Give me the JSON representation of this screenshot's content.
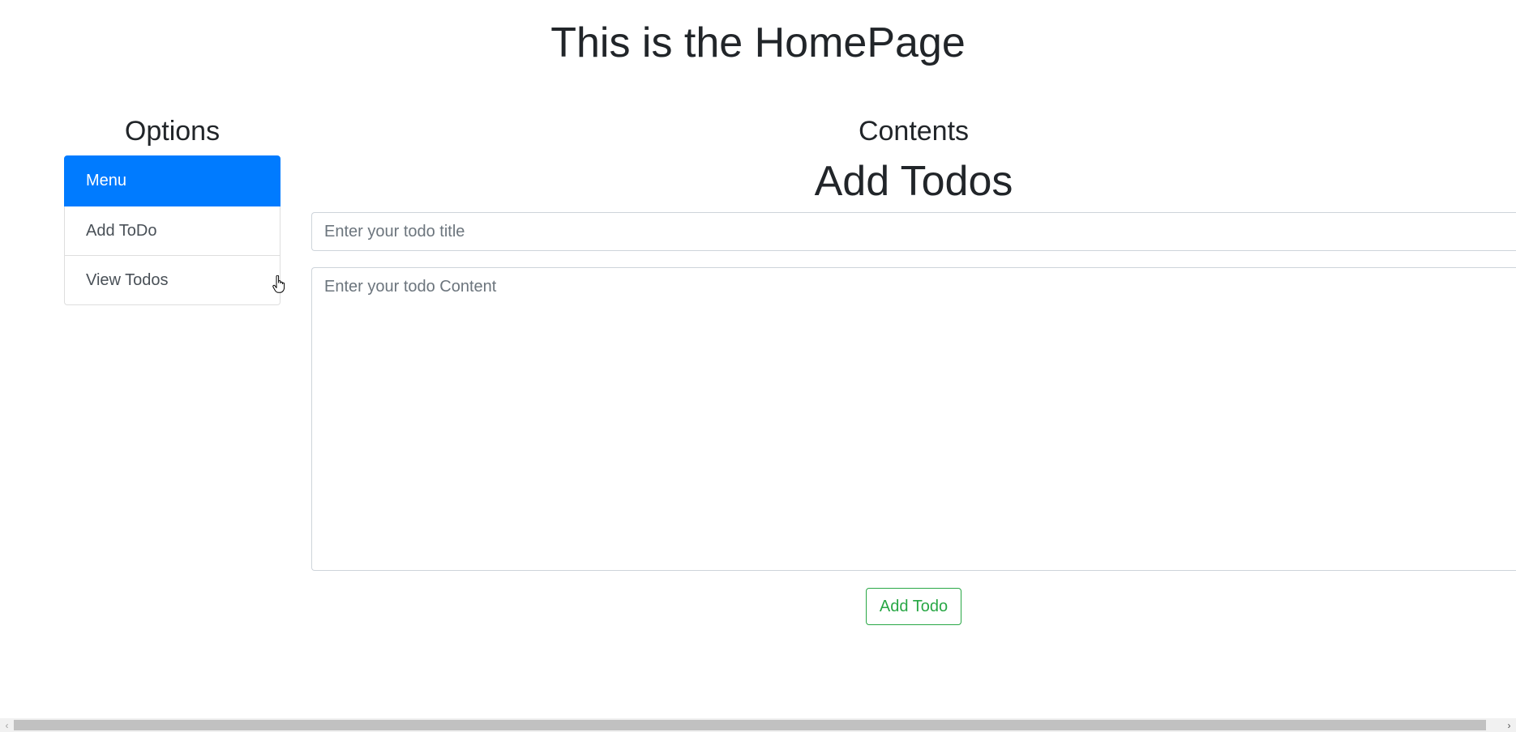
{
  "header": {
    "title": "This is the HomePage"
  },
  "sidebar": {
    "heading": "Options",
    "items": [
      {
        "label": "Menu",
        "active": true
      },
      {
        "label": "Add ToDo",
        "active": false
      },
      {
        "label": "View Todos",
        "active": false
      }
    ]
  },
  "main": {
    "heading": "Contents",
    "form_title": "Add Todos",
    "title_input": {
      "value": "",
      "placeholder": "Enter your todo title"
    },
    "content_input": {
      "value": "",
      "placeholder": "Enter your todo Content"
    },
    "submit_label": "Add Todo"
  },
  "colors": {
    "primary": "#007bff",
    "success": "#28a745",
    "text": "#212529"
  },
  "icons": {
    "cursor": "hand-pointer-icon",
    "scroll_left": "chevron-left-icon",
    "scroll_right": "chevron-right-icon"
  }
}
